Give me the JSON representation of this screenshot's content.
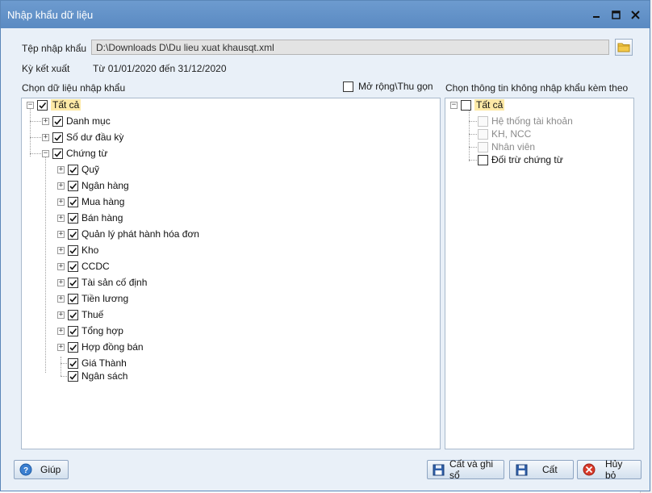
{
  "window": {
    "title": "Nhập khẩu dữ liệu"
  },
  "file": {
    "label": "Tệp nhập khẩu",
    "path": "D:\\Downloads D\\Du lieu xuat khausqt.xml"
  },
  "period": {
    "label": "Kỳ kết xuất",
    "value": "Từ 01/01/2020 đến 31/12/2020"
  },
  "left_panel": {
    "heading": "Chọn dữ liệu nhập khẩu",
    "toggle_label": "Mở rộng\\Thu gọn",
    "root": "Tất cả",
    "items": {
      "danh_muc": "Danh mục",
      "so_du": "Số dư đầu kỳ",
      "chung_tu": "Chứng từ",
      "quy": "Quỹ",
      "ngan_hang": "Ngân hàng",
      "mua_hang": "Mua hàng",
      "ban_hang": "Bán hàng",
      "qlph_hoa_don": "Quản lý phát hành hóa đơn",
      "kho": "Kho",
      "ccdc": "CCDC",
      "tscd": "Tài sản cố định",
      "tien_luong": "Tiền lương",
      "thue": "Thuế",
      "tong_hop": "Tổng hợp",
      "hop_dong_ban": "Hợp đồng bán",
      "gia_thanh": "Giá Thành",
      "ngan_sach": "Ngân sách"
    }
  },
  "right_panel": {
    "heading": "Chọn thông tin không nhập khẩu kèm theo",
    "root": "Tất cả",
    "items": {
      "he_thong_tk": "Hệ thống tài khoản",
      "kh_ncc": "KH, NCC",
      "nhan_vien": "Nhân viên",
      "doi_tru": "Đối trừ chứng từ"
    }
  },
  "buttons": {
    "help": "Giúp",
    "save_and_record": "Cất và ghi sổ",
    "save": "Cất",
    "cancel": "Hủy bỏ"
  },
  "colors": {
    "titlebar": "#5a8ac2",
    "highlight": "#fde9a6"
  }
}
